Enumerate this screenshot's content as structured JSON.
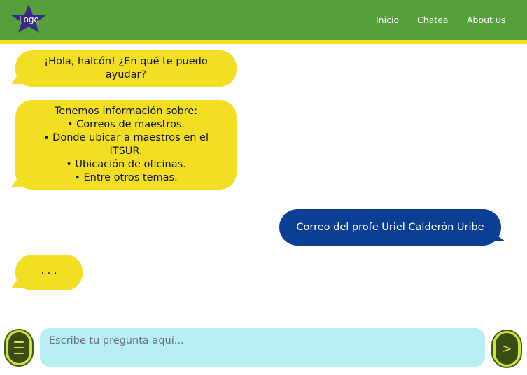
{
  "header": {
    "logo_label": "Logo",
    "nav": [
      "Inicio",
      "Chatea",
      "About us"
    ]
  },
  "chat": {
    "messages": [
      {
        "sender": "bot",
        "text": "¡Hola, halcón! ¿En qué te puedo ayudar?"
      },
      {
        "sender": "bot",
        "intro": "Tenemos información sobre:",
        "items": [
          "Correos de maestros.",
          "Donde ubicar a maestros en el ITSUR.",
          "Ubicación de oficinas.",
          "Entre otros temas."
        ]
      },
      {
        "sender": "user",
        "text": "Correo del profe Uriel Calderón Uribe"
      },
      {
        "sender": "bot",
        "text": ". . ."
      }
    ]
  },
  "composer": {
    "placeholder": "Escribe tu pregunta aquí...",
    "send_label": ">"
  },
  "colors": {
    "header": "#55a03b",
    "accent_line": "#f2df2b",
    "bot_bubble": "#f2df24",
    "user_bubble": "#0a3f93",
    "input_bg": "#b7eef1",
    "button": "#cde53a",
    "logo_star": "#3a2a86"
  },
  "icons": {
    "menu": "hamburger-icon",
    "send": "chevron-right-icon",
    "logo": "star-icon"
  }
}
